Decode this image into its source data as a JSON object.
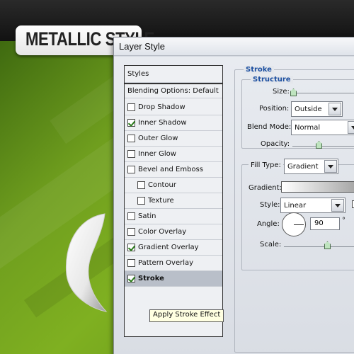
{
  "banner": {
    "text": "METALLIC STYLE"
  },
  "dialog": {
    "title": "Layer Style",
    "styles_header": "Styles",
    "blending_options": "Blending Options: Default",
    "effects": [
      {
        "label": "Drop Shadow",
        "checked": false
      },
      {
        "label": "Inner Shadow",
        "checked": true
      },
      {
        "label": "Outer Glow",
        "checked": false
      },
      {
        "label": "Inner Glow",
        "checked": false
      },
      {
        "label": "Bevel and Emboss",
        "checked": false
      },
      {
        "label": "Contour",
        "checked": false
      },
      {
        "label": "Texture",
        "checked": false
      },
      {
        "label": "Satin",
        "checked": false
      },
      {
        "label": "Color Overlay",
        "checked": false
      },
      {
        "label": "Gradient Overlay",
        "checked": true
      },
      {
        "label": "Pattern Overlay",
        "checked": false
      },
      {
        "label": "Stroke",
        "checked": true
      }
    ],
    "tooltip": "Apply Stroke Effect"
  },
  "stroke": {
    "section_title": "Stroke",
    "structure_title": "Structure",
    "size_label": "Size:",
    "position_label": "Position:",
    "position_value": "Outside",
    "blend_mode_label": "Blend Mode:",
    "blend_mode_value": "Normal",
    "opacity_label": "Opacity:",
    "fill_type_label": "Fill Type:",
    "fill_type_value": "Gradient",
    "gradient_label": "Gradient:",
    "style_label": "Style:",
    "style_value": "Linear",
    "angle_label": "Angle:",
    "angle_value": "90",
    "angle_unit": "°",
    "scale_label": "Scale:"
  }
}
